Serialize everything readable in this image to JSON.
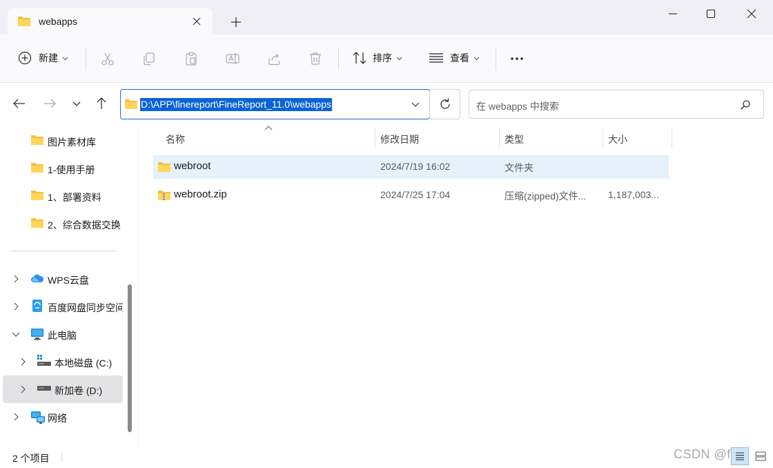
{
  "window": {
    "tab_title": "webapps"
  },
  "toolbar": {
    "new_label": "新建",
    "sort_label": "排序",
    "view_label": "查看"
  },
  "address": {
    "path": "D:\\APP\\finereport\\FineReport_11.0\\webapps",
    "search_placeholder": "在 webapps 中搜索"
  },
  "nav": {
    "quick_items": [
      {
        "label": "图片素材库"
      },
      {
        "label": "1-使用手册"
      },
      {
        "label": "1、部署资料"
      },
      {
        "label": "2、综合数据交换"
      }
    ],
    "wps_label": "WPS云盘",
    "baidu_label": "百度网盘同步空间",
    "pc_label": "此电脑",
    "drive_c_label": "本地磁盘 (C:)",
    "drive_d_label": "新加卷 (D:)",
    "network_label": "网络"
  },
  "columns": {
    "name": "名称",
    "date": "修改日期",
    "type": "类型",
    "size": "大小"
  },
  "files": [
    {
      "name": "webroot",
      "date": "2024/7/19 16:02",
      "type": "文件夹",
      "size": ""
    },
    {
      "name": "webroot.zip",
      "date": "2024/7/25 17:04",
      "type": "压缩(zipped)文件...",
      "size": "1,187,003..."
    }
  ],
  "status": {
    "count": "2 个项目"
  },
  "watermark": "CSDN @f-r-"
}
